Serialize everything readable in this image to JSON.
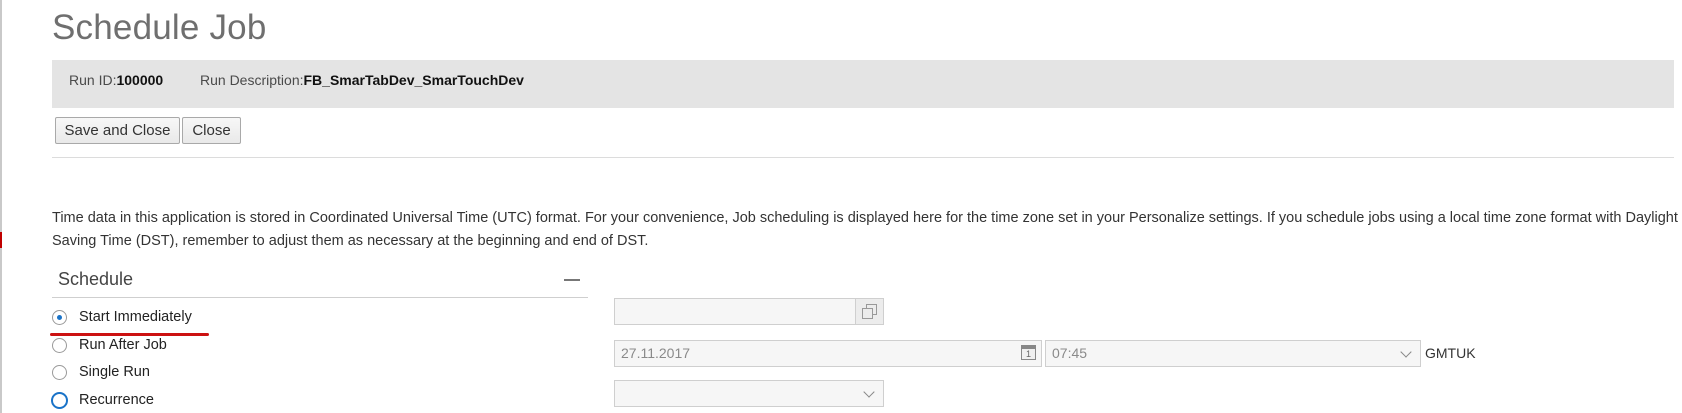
{
  "page": {
    "title": "Schedule Job"
  },
  "info": {
    "run_id_label": "Run ID:",
    "run_id_value": "100000",
    "run_desc_label": "Run Description:",
    "run_desc_value": "FB_SmarTabDev_SmarTouchDev"
  },
  "toolbar": {
    "save_close_label": "Save and Close",
    "close_label": "Close"
  },
  "notice": "Time data in this application is stored in Coordinated Universal Time (UTC) format. For your convenience, Job scheduling is displayed here for the time zone set in your Personalize settings. If you schedule jobs using a local time zone format with Daylight Saving Time (DST), remember to adjust them as necessary at the beginning and end of DST.",
  "schedule": {
    "title": "Schedule",
    "options": [
      {
        "label": "Start Immediately",
        "selected": true
      },
      {
        "label": "Run After Job",
        "selected": false
      },
      {
        "label": "Single Run",
        "selected": false
      },
      {
        "label": "Recurrence",
        "selected": false
      }
    ],
    "job_field_value": "",
    "date_value": "27.11.2017",
    "time_value": "07:45",
    "timezone": "GMTUK",
    "recurrence_value": ""
  },
  "colors": {
    "accent": "#1a73c8",
    "annotation": "#cc1111",
    "info_bar": "#e4e4e4"
  }
}
